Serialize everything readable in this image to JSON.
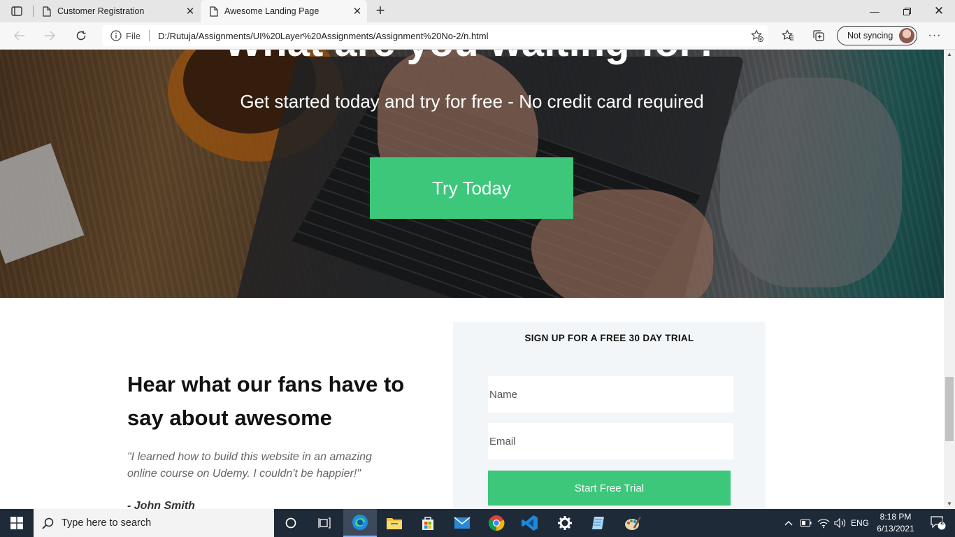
{
  "browser": {
    "tabs": [
      {
        "title": "Customer Registration",
        "active": false
      },
      {
        "title": "Awesome Landing Page",
        "active": true
      }
    ],
    "file_label": "File",
    "url": "D:/Rutuja/Assignments/UI%20Layer%20Assignments/Assignment%20No-2/n.html",
    "profile_label": "Not syncing"
  },
  "hero": {
    "heading": "What are you waiting for?",
    "subheading": "Get started today and try for free - No credit card required",
    "cta_label": "Try Today"
  },
  "testimonial": {
    "title": "Hear what our fans have to say about awesome",
    "quote": "\"I learned how to build this website in an amazing online course on Udemy. I couldn't be happier!\"",
    "author": "- John Smith"
  },
  "signup": {
    "title": "SIGN UP FOR A FREE 30 DAY TRIAL",
    "name_placeholder": "Name",
    "email_placeholder": "Email",
    "submit_label": "Start Free Trial"
  },
  "taskbar": {
    "search_placeholder": "Type here to search",
    "language": "ENG",
    "time": "8:18 PM",
    "date": "6/13/2021",
    "notification_count": "2"
  },
  "colors": {
    "accent_green": "#3cc77b",
    "signup_bg": "#f3f6f9",
    "taskbar_bg": "#1f2a38"
  }
}
